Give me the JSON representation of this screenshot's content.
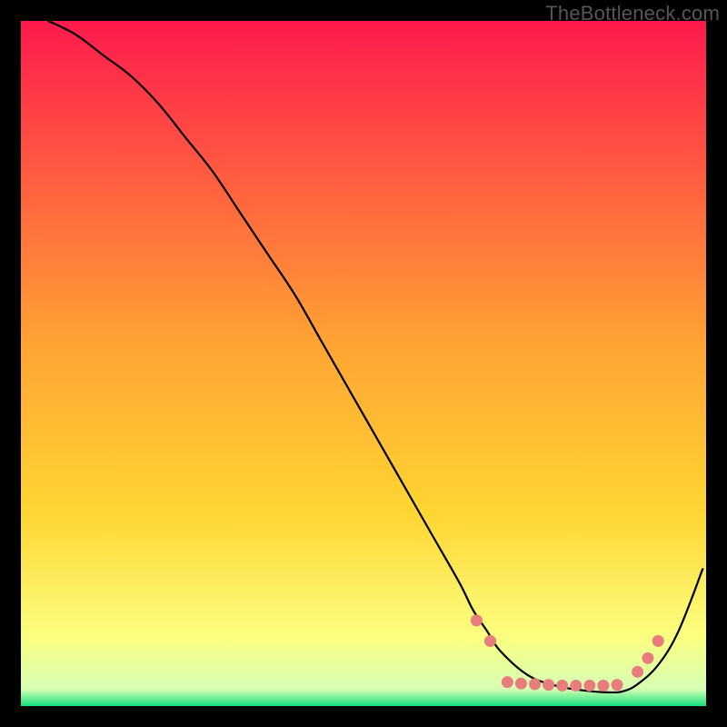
{
  "watermark": "TheBottleneck.com",
  "chart_data": {
    "type": "line",
    "title": "",
    "xlabel": "",
    "ylabel": "",
    "xlim": [
      0,
      100
    ],
    "ylim": [
      0,
      100
    ],
    "grid": false,
    "legend": false,
    "gradient_background": {
      "top_color": "#ff1a4d",
      "mid_color": "#ffd633",
      "lower_color": "#fbff80",
      "bottom_color": "#14e07a"
    },
    "series": [
      {
        "name": "curve",
        "color": "#000000",
        "x": [
          4,
          8,
          12,
          16,
          20,
          24,
          28,
          32,
          36,
          40,
          44,
          48,
          52,
          56,
          60,
          64,
          66,
          68,
          70,
          74,
          78,
          82,
          86,
          88,
          90,
          93,
          96,
          99.5
        ],
        "y": [
          100,
          98,
          95,
          92,
          88,
          83,
          78,
          72,
          66,
          60,
          53,
          46,
          39,
          32,
          25,
          18,
          14,
          11,
          8,
          4.5,
          3,
          2.3,
          2,
          2.2,
          3.2,
          6,
          11,
          20
        ]
      }
    ],
    "markers": {
      "name": "highlight-dots",
      "color": "#e77d7d",
      "points": [
        {
          "x": 66.5,
          "y": 12.5
        },
        {
          "x": 68.5,
          "y": 9.5
        },
        {
          "x": 71,
          "y": 3.5
        },
        {
          "x": 73,
          "y": 3.3
        },
        {
          "x": 75,
          "y": 3.2
        },
        {
          "x": 77,
          "y": 3.1
        },
        {
          "x": 79,
          "y": 3.0
        },
        {
          "x": 81,
          "y": 3.0
        },
        {
          "x": 83,
          "y": 3.0
        },
        {
          "x": 85,
          "y": 3.0
        },
        {
          "x": 87,
          "y": 3.1
        },
        {
          "x": 90,
          "y": 5.0
        },
        {
          "x": 91.5,
          "y": 7.0
        },
        {
          "x": 93,
          "y": 9.5
        }
      ]
    }
  }
}
